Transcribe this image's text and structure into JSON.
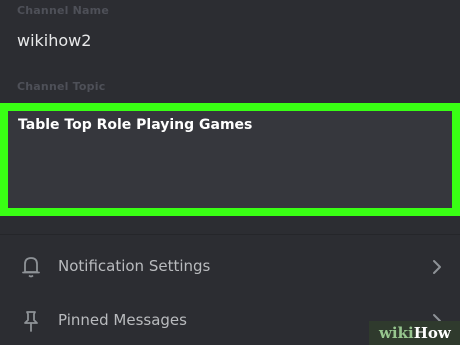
{
  "channel_name": {
    "label": "Channel Name",
    "value": "wikihow2"
  },
  "channel_topic": {
    "label": "Channel Topic",
    "value": "Table Top Role Playing Games",
    "highlight_color": "#39ff14"
  },
  "settings": {
    "notification": {
      "label": "Notification Settings",
      "icon": "bell-icon"
    },
    "pinned": {
      "label": "Pinned Messages",
      "icon": "pin-icon"
    }
  },
  "watermark": {
    "wiki": "wiki",
    "how": "How"
  }
}
